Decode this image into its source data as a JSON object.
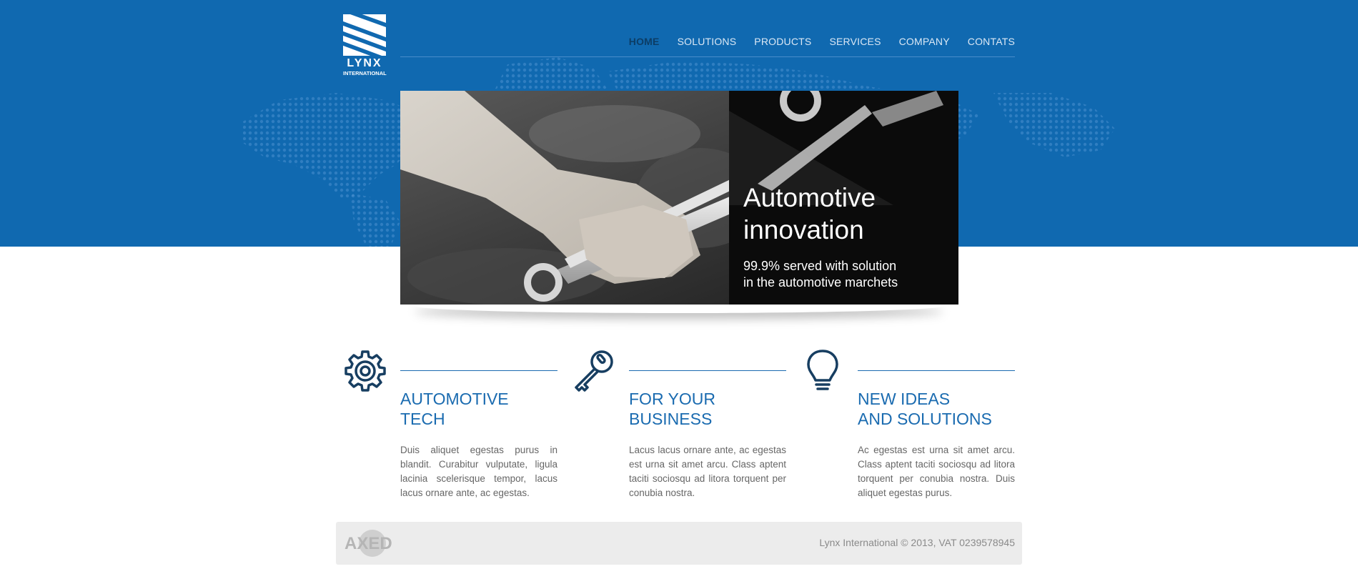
{
  "brand": {
    "name": "LYNX",
    "subtitle": "INTERNATIONAL"
  },
  "nav": {
    "items": [
      {
        "label": "HOME",
        "active": true
      },
      {
        "label": "SOLUTIONS",
        "active": false
      },
      {
        "label": "PRODUCTS",
        "active": false
      },
      {
        "label": "SERVICES",
        "active": false
      },
      {
        "label": "COMPANY",
        "active": false
      },
      {
        "label": "CONTATS",
        "active": false
      }
    ]
  },
  "hero": {
    "title_line1": "Automotive",
    "title_line2": "innovation",
    "subtitle_line1": "99.9% served with solution",
    "subtitle_line2": "in the automotive marchets"
  },
  "features": [
    {
      "icon": "gear-icon",
      "title_line1": "AUTOMOTIVE",
      "title_line2": "TECH",
      "body": "Duis aliquet egestas purus in blandit. Curabitur vulputate, ligula lacinia scelerisque tempor, lacus lacus ornare ante, ac egestas."
    },
    {
      "icon": "key-icon",
      "title_line1": "FOR YOUR",
      "title_line2": "BUSINESS",
      "body": "Lacus lacus ornare ante, ac egestas est urna sit amet arcu. Class aptent taciti sociosqu ad litora torquent per conubia nostra."
    },
    {
      "icon": "lightbulb-icon",
      "title_line1": "NEW IDEAS",
      "title_line2": "AND SOLUTIONS",
      "body": "Ac egestas est urna sit amet arcu. Class aptent taciti sociosqu ad litora torquent per conubia nostra. Duis aliquet egestas purus."
    }
  ],
  "footer": {
    "copyright": "Lynx International © 2013, VAT 0239578945",
    "partner_logo": "AXED"
  },
  "colors": {
    "band_blue": "#1069b0",
    "accent_blue": "#1a6bb0",
    "icon_navy": "#173e61",
    "nav_active": "#0c3d66"
  }
}
